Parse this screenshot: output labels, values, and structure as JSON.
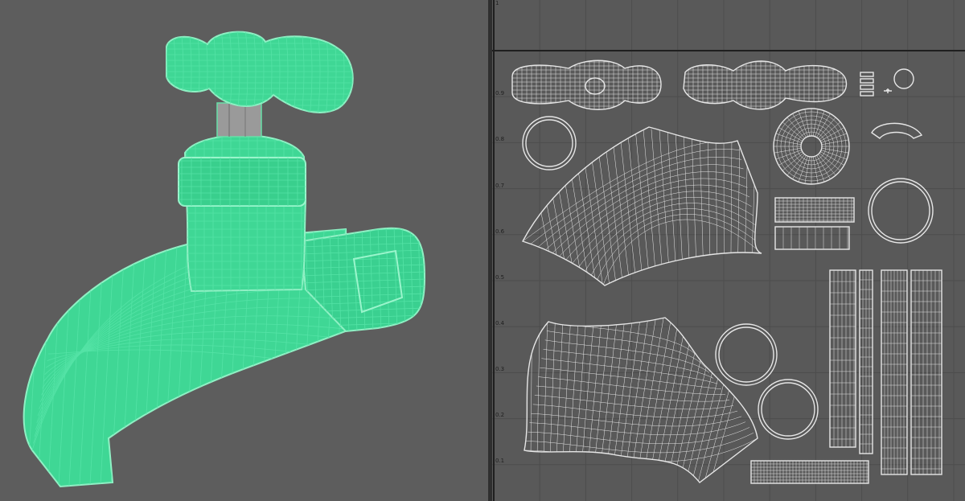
{
  "viewport": {
    "object": "water-tap-faucet",
    "display_mode": "wireframe-on-shaded",
    "wire_color": "#54e3a6",
    "shade_color": "#3fd795",
    "background": "#5d5d5d"
  },
  "uv_editor": {
    "background": "#595959",
    "grid_color": "#4d4d4d",
    "uv_color": "#e6e6e6",
    "axis_labels": [
      "0.9",
      "0.8",
      "0.7",
      "0.6",
      "0.5",
      "0.4",
      "0.3",
      "0.2",
      "0.1"
    ],
    "top_ruler_label": "1"
  }
}
